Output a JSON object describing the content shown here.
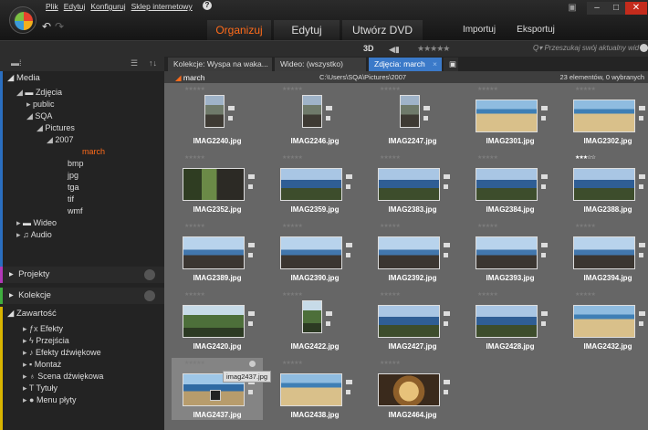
{
  "app": {
    "menu": [
      "Plik",
      "Edytuj",
      "Konfiguruj",
      "Sklep internetowy"
    ],
    "tabs": [
      "Organizuj",
      "Edytuj",
      "Utwórz DVD"
    ],
    "active_tab": "Organizuj",
    "small_buttons": [
      "Importuj",
      "Eksportuj"
    ],
    "accent_color": "#ff6b1a",
    "selection_color": "#3b7ac9"
  },
  "toolbar": {
    "three_d": "3D",
    "stars": "★★★★★",
    "search_placeholder": "Przeszukaj swój aktualny wid"
  },
  "sidebar": {
    "media_label": "Media",
    "tree": [
      {
        "label": "Zdjęcia",
        "indent": 0,
        "arrow": "◢",
        "icon": "photo-icon"
      },
      {
        "label": "public",
        "indent": 1,
        "arrow": "▸",
        "icon": ""
      },
      {
        "label": "SQA",
        "indent": 1,
        "arrow": "◢",
        "icon": ""
      },
      {
        "label": "Pictures",
        "indent": 2,
        "arrow": "◢",
        "icon": ""
      },
      {
        "label": "2007",
        "indent": 3,
        "arrow": "◢",
        "icon": ""
      },
      {
        "label": "march",
        "indent": 4,
        "arrow": "",
        "icon": "",
        "selected": true
      },
      {
        "label": "bmp",
        "indent": 3,
        "arrow": "",
        "icon": ""
      },
      {
        "label": "jpg",
        "indent": 3,
        "arrow": "",
        "icon": ""
      },
      {
        "label": "tga",
        "indent": 3,
        "arrow": "",
        "icon": ""
      },
      {
        "label": "tif",
        "indent": 3,
        "arrow": "",
        "icon": ""
      },
      {
        "label": "wmf",
        "indent": 3,
        "arrow": "",
        "icon": ""
      },
      {
        "label": "Wideo",
        "indent": 0,
        "arrow": "▸",
        "icon": "video-icon"
      },
      {
        "label": "Audio",
        "indent": 0,
        "arrow": "▸",
        "icon": "audio-icon"
      }
    ],
    "projects_label": "Projekty",
    "collections_label": "Kolekcje",
    "content_label": "Zawartość",
    "content_items": [
      {
        "label": "Efekty",
        "icon": "fx-icon",
        "glyph": "ƒx"
      },
      {
        "label": "Przejścia",
        "icon": "lightning-icon",
        "glyph": "ϟ"
      },
      {
        "label": "Efekty dźwiękowe",
        "icon": "music-note-icon",
        "glyph": "♪"
      },
      {
        "label": "Montaż",
        "icon": "montage-icon",
        "glyph": "▪"
      },
      {
        "label": "Scena dźwiękowa",
        "icon": "soundscape-icon",
        "glyph": "♁"
      },
      {
        "label": "Tytuły",
        "icon": "title-icon",
        "glyph": "T"
      },
      {
        "label": "Menu płyty",
        "icon": "disc-menu-icon",
        "glyph": "●"
      }
    ]
  },
  "content_tabs": [
    {
      "label": "Kolekcje: Wyspa na waka...",
      "active": false
    },
    {
      "label": "Wideo: (wszystko)",
      "active": false
    },
    {
      "label": "Zdjęcia: march",
      "active": true
    }
  ],
  "path_bar": {
    "folder": "march",
    "path": "C:\\Users\\SQA\\Pictures\\2007",
    "count": "23 elementów, 0 wybranych"
  },
  "photos": [
    {
      "name": "IMAG2240.jpg",
      "orientation": "portrait",
      "theme": "people",
      "stars": 0
    },
    {
      "name": "IMAG2246.jpg",
      "orientation": "portrait",
      "theme": "people",
      "stars": 0
    },
    {
      "name": "IMAG2247.jpg",
      "orientation": "portrait",
      "theme": "people",
      "stars": 0
    },
    {
      "name": "IMAG2301.jpg",
      "orientation": "landscape",
      "theme": "beach",
      "stars": 0
    },
    {
      "name": "IMAG2302.jpg",
      "orientation": "landscape",
      "theme": "beach",
      "stars": 0
    },
    {
      "name": "IMAG2352.jpg",
      "orientation": "landscape",
      "theme": "cave",
      "stars": 0
    },
    {
      "name": "IMAG2359.jpg",
      "orientation": "landscape",
      "theme": "coast",
      "stars": 0
    },
    {
      "name": "IMAG2383.jpg",
      "orientation": "landscape",
      "theme": "coast",
      "stars": 0
    },
    {
      "name": "IMAG2384.jpg",
      "orientation": "landscape",
      "theme": "coast",
      "stars": 0
    },
    {
      "name": "IMAG2388.jpg",
      "orientation": "landscape",
      "theme": "coast",
      "stars": 3
    },
    {
      "name": "IMAG2389.jpg",
      "orientation": "landscape",
      "theme": "rocks",
      "stars": 0
    },
    {
      "name": "IMAG2390.jpg",
      "orientation": "landscape",
      "theme": "rocks",
      "stars": 0
    },
    {
      "name": "IMAG2392.jpg",
      "orientation": "landscape",
      "theme": "rocks",
      "stars": 0
    },
    {
      "name": "IMAG2393.jpg",
      "orientation": "landscape",
      "theme": "rocks",
      "stars": 0
    },
    {
      "name": "IMAG2394.jpg",
      "orientation": "landscape",
      "theme": "rocks",
      "stars": 0
    },
    {
      "name": "IMAG2420.jpg",
      "orientation": "landscape",
      "theme": "green",
      "stars": 0
    },
    {
      "name": "IMAG2422.jpg",
      "orientation": "portrait",
      "theme": "green",
      "stars": 0
    },
    {
      "name": "IMAG2427.jpg",
      "orientation": "landscape",
      "theme": "coast",
      "stars": 0
    },
    {
      "name": "IMAG2428.jpg",
      "orientation": "landscape",
      "theme": "coast",
      "stars": 0
    },
    {
      "name": "IMAG2432.jpg",
      "orientation": "landscape",
      "theme": "beach",
      "stars": 0
    },
    {
      "name": "IMAG2437.jpg",
      "orientation": "landscape",
      "theme": "bay",
      "stars": 0,
      "selected": true,
      "tooltip": "imag2437.jpg"
    },
    {
      "name": "IMAG2438.jpg",
      "orientation": "landscape",
      "theme": "beach",
      "stars": 0
    },
    {
      "name": "IMAG2464.jpg",
      "orientation": "landscape",
      "theme": "food",
      "stars": 0
    }
  ]
}
